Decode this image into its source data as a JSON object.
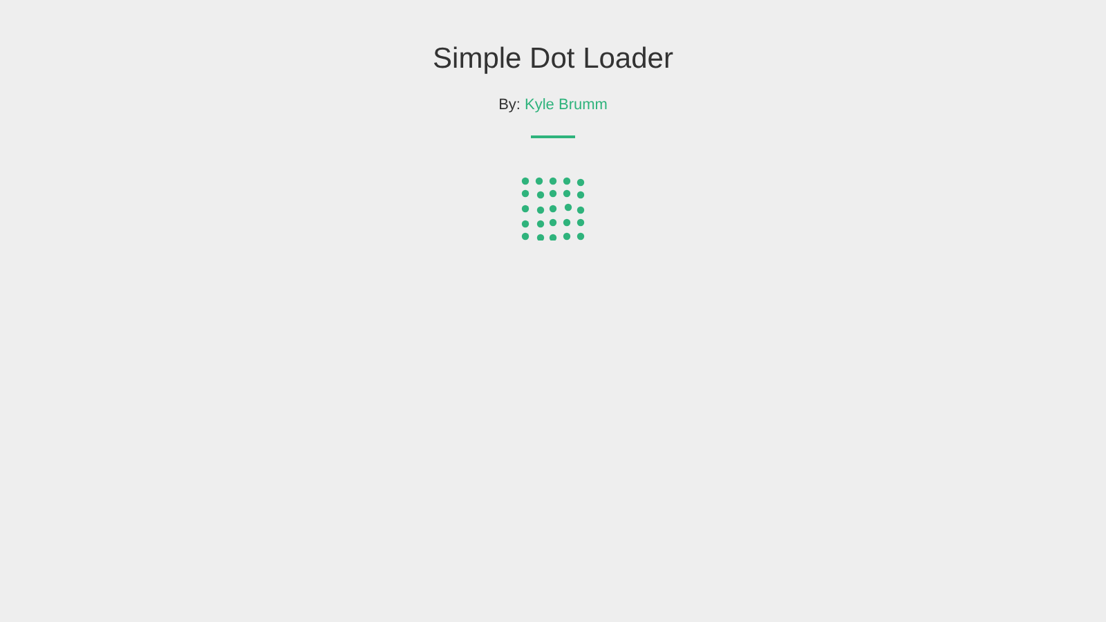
{
  "title": "Simple Dot Loader",
  "byline": {
    "prefix": "By:",
    "author": "Kyle Brumm"
  }
}
